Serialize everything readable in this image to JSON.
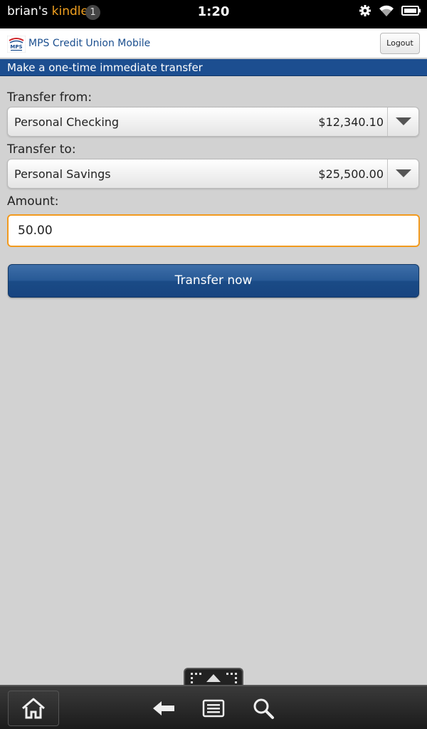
{
  "status_bar": {
    "owner": "brian's",
    "brand": "kindle",
    "notification_count": "1",
    "time": "1:20",
    "icons": [
      "gear-icon",
      "wifi-icon",
      "battery-icon"
    ]
  },
  "app": {
    "title": "MPS Credit Union Mobile",
    "logo_text": "MPS",
    "logout_label": "Logout",
    "page_heading": "Make a one-time immediate transfer"
  },
  "form": {
    "from_label": "Transfer from:",
    "from_account": "Personal Checking",
    "from_balance": "$12,340.10",
    "to_label": "Transfer to:",
    "to_account": "Personal Savings",
    "to_balance": "$25,500.00",
    "amount_label": "Amount:",
    "amount_value": "50.00",
    "submit_label": "Transfer now"
  },
  "nav": {
    "icons": [
      "home-icon",
      "back-icon",
      "menu-icon",
      "search-icon"
    ]
  },
  "colors": {
    "brand_blue": "#1c4e90",
    "focus_orange": "#f29a1e",
    "kindle_orange": "#f0a020"
  }
}
